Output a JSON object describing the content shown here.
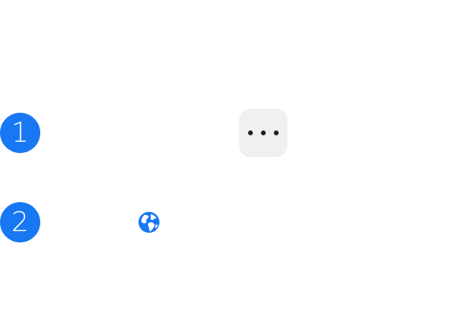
{
  "steps": [
    {
      "number": "1"
    },
    {
      "number": "2"
    }
  ],
  "icons": {
    "more": "more-options-icon",
    "globe": "globe-icon"
  },
  "colors": {
    "badge": "#1877f2",
    "button_bg": "#f0f0f2",
    "icon_dark": "#1c1e21"
  }
}
